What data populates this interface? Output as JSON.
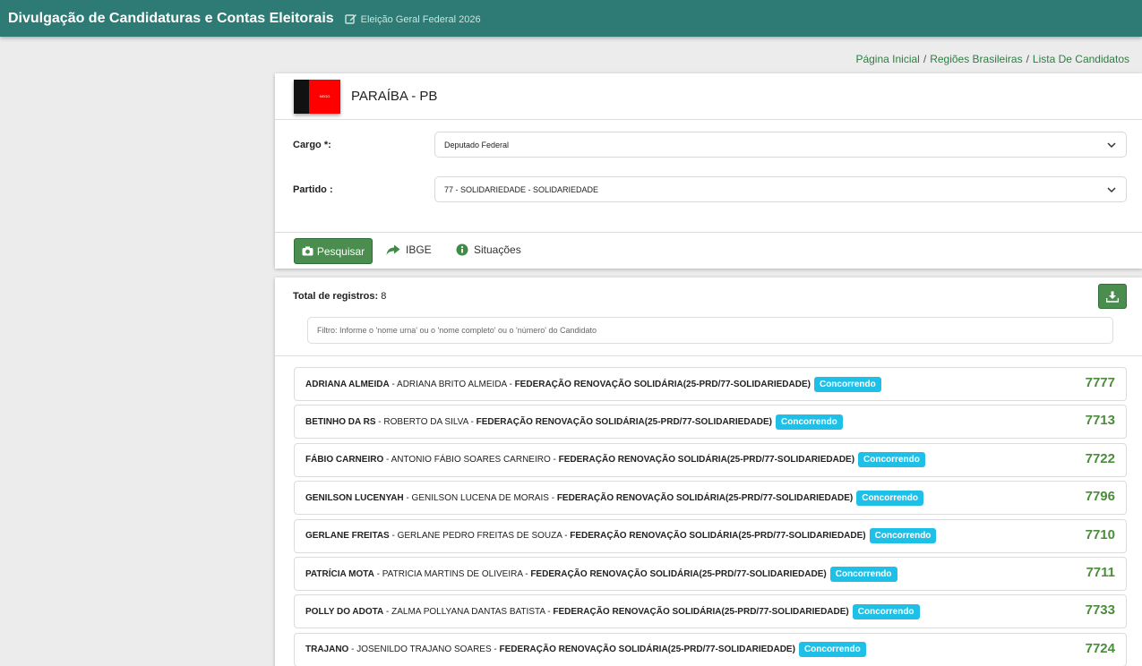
{
  "header": {
    "title": "Divulgação de Candidaturas e Contas Eleitorais",
    "subtitle": "Eleição Geral Federal 2026"
  },
  "breadcrumb": {
    "items": [
      "Página Inicial",
      "Regiões Brasileiras",
      "Lista De Candidatos"
    ],
    "separator": "/"
  },
  "state": {
    "name": "PARAÍBA - PB",
    "flag_text": "NEGO"
  },
  "form": {
    "cargo_label": "Cargo *:",
    "cargo_value": "Deputado Federal",
    "partido_label": "Partido :",
    "partido_value": "77 - SOLIDARIEDADE - SOLIDARIEDADE"
  },
  "actions": {
    "search_label": "Pesquisar",
    "ibge_label": "IBGE",
    "situacoes_label": "Situações"
  },
  "results": {
    "total_label": "Total de registros:",
    "total_value": "8",
    "filter_placeholder": "Filtro: Informe o 'nome urna' ou o 'nome completo' ou o 'número' do Candidato"
  },
  "candidates": [
    {
      "nick": "ADRIANA ALMEIDA",
      "full": "ADRIANA BRITO ALMEIDA",
      "party": "FEDERAÇÃO RENOVAÇÃO SOLIDÁRIA(25-PRD/77-SOLIDARIEDADE)",
      "status": "Concorrendo",
      "number": "7777"
    },
    {
      "nick": "BETINHO DA RS",
      "full": "ROBERTO DA SILVA",
      "party": "FEDERAÇÃO RENOVAÇÃO SOLIDÁRIA(25-PRD/77-SOLIDARIEDADE)",
      "status": "Concorrendo",
      "number": "7713"
    },
    {
      "nick": "FÁBIO CARNEIRO",
      "full": "ANTONIO FÁBIO SOARES CARNEIRO",
      "party": "FEDERAÇÃO RENOVAÇÃO SOLIDÁRIA(25-PRD/77-SOLIDARIEDADE)",
      "status": "Concorrendo",
      "number": "7722"
    },
    {
      "nick": "GENILSON LUCENYAH",
      "full": "GENILSON LUCENA DE MORAIS",
      "party": "FEDERAÇÃO RENOVAÇÃO SOLIDÁRIA(25-PRD/77-SOLIDARIEDADE)",
      "status": "Concorrendo",
      "number": "7796"
    },
    {
      "nick": "GERLANE FREITAS",
      "full": "GERLANE PEDRO FREITAS DE SOUZA",
      "party": "FEDERAÇÃO RENOVAÇÃO SOLIDÁRIA(25-PRD/77-SOLIDARIEDADE)",
      "status": "Concorrendo",
      "number": "7710"
    },
    {
      "nick": "PATRÍCIA MOTA",
      "full": "PATRICIA MARTINS DE OLIVEIRA",
      "party": "FEDERAÇÃO RENOVAÇÃO SOLIDÁRIA(25-PRD/77-SOLIDARIEDADE)",
      "status": "Concorrendo",
      "number": "7711"
    },
    {
      "nick": "POLLY DO ADOTA",
      "full": "ZALMA POLLYANA DANTAS BATISTA",
      "party": "FEDERAÇÃO RENOVAÇÃO SOLIDÁRIA(25-PRD/77-SOLIDARIEDADE)",
      "status": "Concorrendo",
      "number": "7733"
    },
    {
      "nick": "TRAJANO",
      "full": "JOSENILDO TRAJANO SOARES",
      "party": "FEDERAÇÃO RENOVAÇÃO SOLIDÁRIA(25-PRD/77-SOLIDARIEDADE)",
      "status": "Concorrendo",
      "number": "7724"
    }
  ],
  "colors": {
    "topbar": "#2e7a74",
    "primary_button": "#4a8d4e",
    "badge": "#1fc0e8",
    "number": "#4a8d3a",
    "link": "#2f7d43"
  },
  "icons": {
    "edit": "edit-icon",
    "camera": "camera-icon",
    "share": "share-icon",
    "info": "info-icon",
    "download": "download-icon",
    "chevron": "chevron-down-icon"
  }
}
